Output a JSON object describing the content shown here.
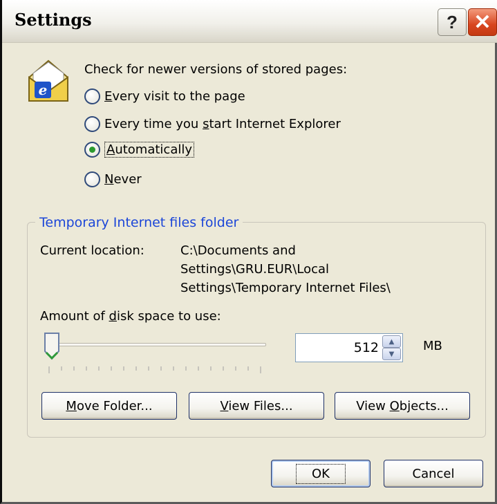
{
  "window": {
    "title": "Settings"
  },
  "titlebar": {
    "help_label": "?",
    "close_label": "✕"
  },
  "check_section": {
    "prompt": "Check for newer versions of stored pages:",
    "options": [
      {
        "pre": "",
        "key": "E",
        "post": "very visit to the page",
        "selected": false
      },
      {
        "pre": "Every time you ",
        "key": "s",
        "post": "tart Internet Explorer",
        "selected": false
      },
      {
        "pre": "",
        "key": "A",
        "post": "utomatically",
        "selected": true
      },
      {
        "pre": "",
        "key": "N",
        "post": "ever",
        "selected": false
      }
    ]
  },
  "temp_folder": {
    "legend": "Temporary Internet files folder",
    "location_label": "Current location:",
    "location_lines": [
      "C:\\Documents and",
      "Settings\\GRU.EUR\\Local",
      "Settings\\Temporary Internet Files\\"
    ],
    "disk_label_pre": "Amount of ",
    "disk_label_key": "d",
    "disk_label_post": "isk space to use:",
    "disk_value": "512",
    "disk_unit": "MB",
    "slider_level": 0.0,
    "buttons": {
      "move": {
        "key": "M",
        "post": "ove Folder..."
      },
      "view_files": {
        "key": "V",
        "post": "iew Files..."
      },
      "view_objects": {
        "pre": "View ",
        "key": "O",
        "post": "bjects..."
      }
    }
  },
  "footer": {
    "ok_label": "OK",
    "cancel_label": "Cancel"
  },
  "colors": {
    "accent": "#1c46d8",
    "close": "#d8451f",
    "face": "#ece9d8"
  }
}
